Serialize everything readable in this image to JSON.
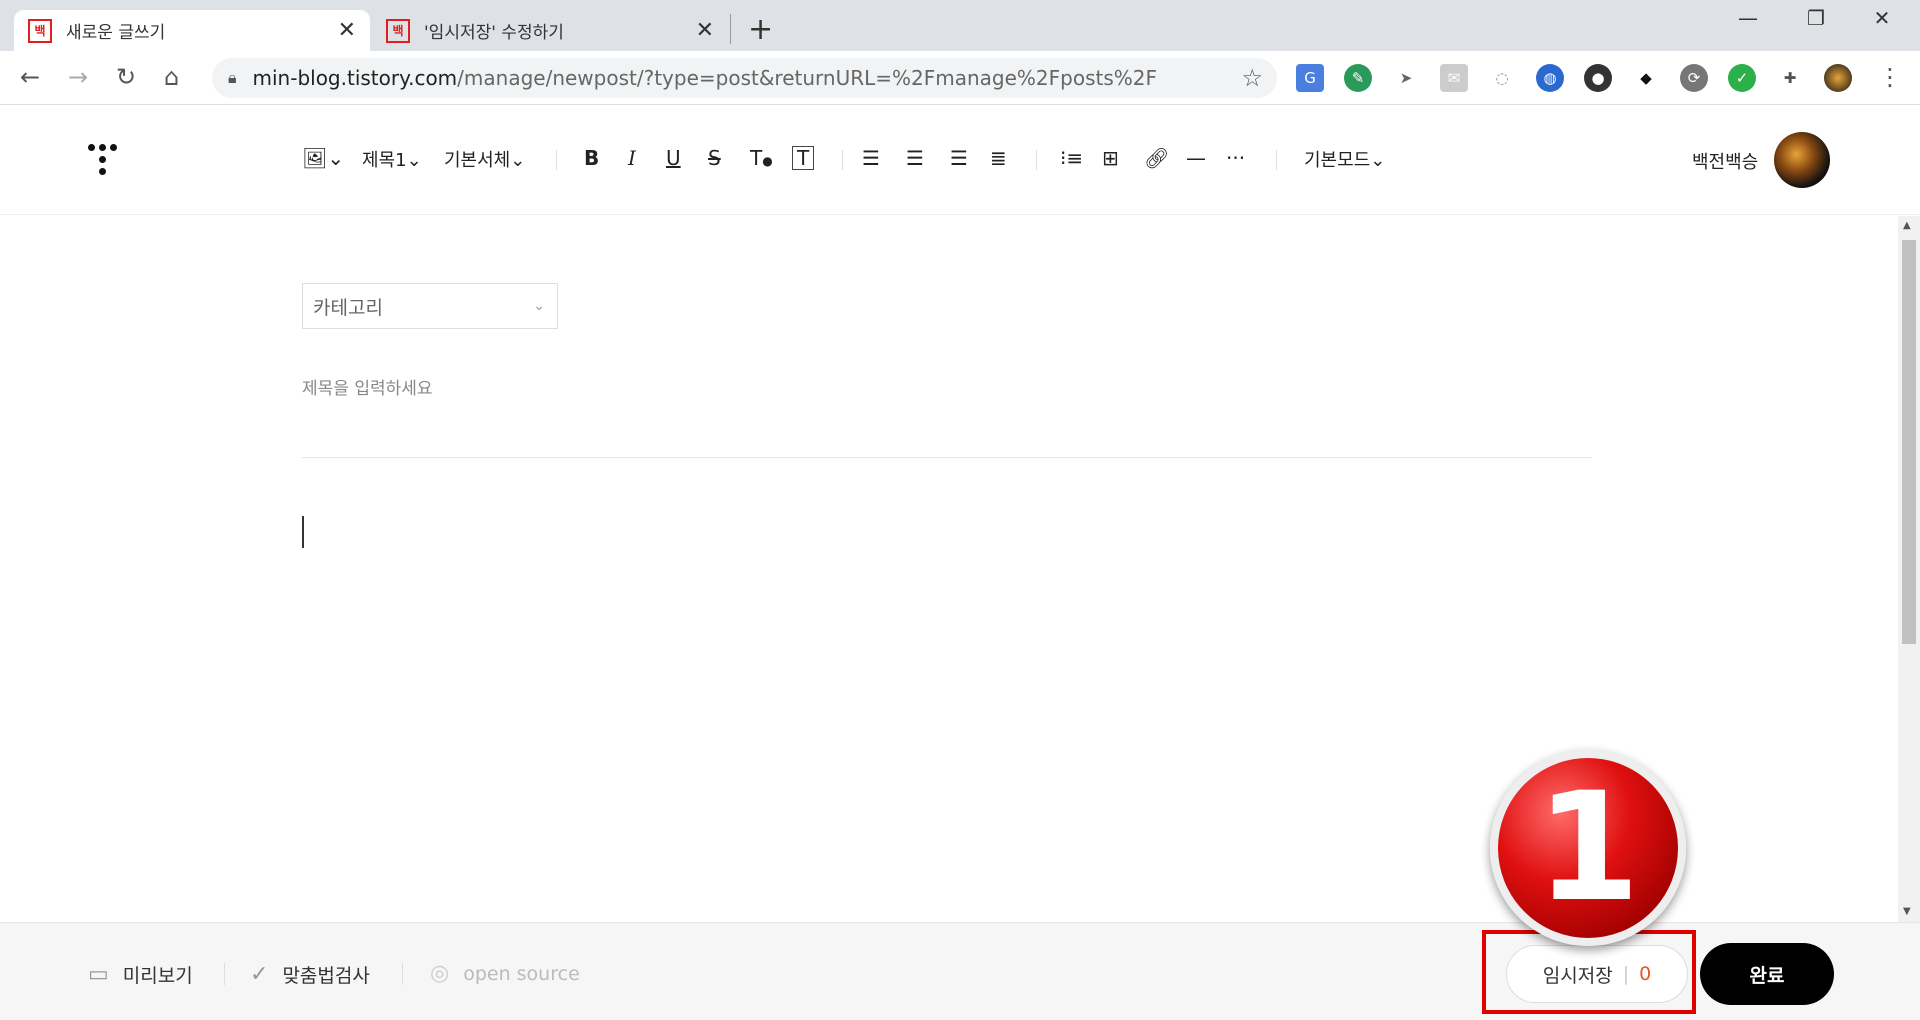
{
  "browser": {
    "tabs": [
      {
        "favicon": "백",
        "title": "새로운 글쓰기"
      },
      {
        "favicon": "백",
        "title": "'임시저장' 수정하기"
      }
    ],
    "url_domain": "min-blog.tistory.com",
    "url_path": "/manage/newpost/?type=post&returnURL=%2Fmanage%2Fposts%2F"
  },
  "toolbar": {
    "heading": "제목1",
    "font": "기본서체",
    "mode": "기본모드",
    "bold": "B",
    "italic": "I",
    "underline": "U",
    "strike": "S",
    "textcolor": "T",
    "textbg": "T",
    "more": "···"
  },
  "user": {
    "name": "백전백승"
  },
  "editor": {
    "category_placeholder": "카테고리",
    "title_placeholder": "제목을 입력하세요"
  },
  "footer": {
    "preview": "미리보기",
    "spellcheck": "맞춤법검사",
    "opensource": "open source",
    "save_label": "임시저장",
    "save_count": "0",
    "done_label": "완료"
  },
  "annotation": {
    "marker": "1"
  },
  "colors": {
    "accent_red": "#e00000",
    "count_orange": "#e05a2a",
    "done_black": "#000000"
  }
}
